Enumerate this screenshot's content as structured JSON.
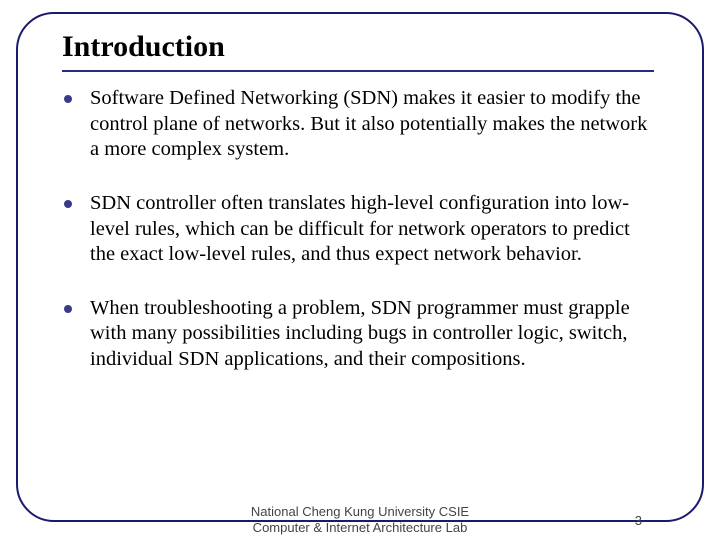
{
  "title": "Introduction",
  "bullets": [
    "Software Defined Networking (SDN) makes it easier to modify the control plane of networks. But it also potentially makes the network a more complex system.",
    "SDN controller often translates high-level configuration into low-level rules, which can be difficult for network operators to predict the exact low-level rules, and thus expect network behavior.",
    "When troubleshooting a problem, SDN programmer must grapple with many possibilities including bugs in controller logic, switch, individual SDN applications, and their compositions."
  ],
  "footer": {
    "line1": "National Cheng Kung University CSIE",
    "line2": "Computer & Internet Architecture Lab",
    "page": "3"
  },
  "colors": {
    "accent": "#2a2a80"
  }
}
